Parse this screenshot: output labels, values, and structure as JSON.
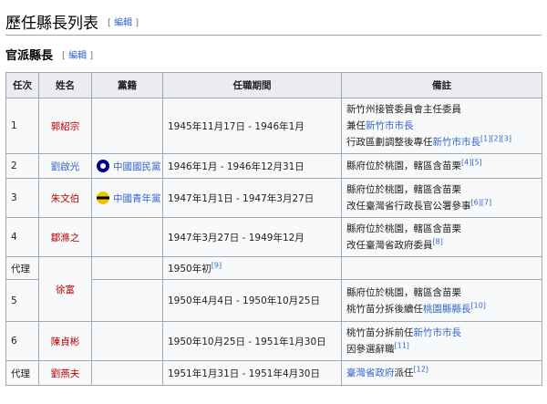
{
  "heading": {
    "title": "歷任縣長列表",
    "edit": "編輯"
  },
  "subheading": {
    "title": "官派縣長",
    "edit": "編輯"
  },
  "columns": [
    "任次",
    "姓名",
    "黨籍",
    "任職期間",
    "備註"
  ],
  "rows": {
    "r1": {
      "no": "1",
      "name": "郭紹宗",
      "period": "1945年11月17日 - 1946年1月",
      "note1": "新竹州接管委員會主任委員",
      "note2_pre": "兼任",
      "note2_link": "新竹市市長",
      "note3_pre": "行政區劃調整後專任",
      "note3_link": "新竹市市長",
      "note3_ref": "[1][2][3]"
    },
    "r2": {
      "no": "2",
      "name": "劉啟光",
      "party": "中國國民黨",
      "party_icon": "kmt-emblem-icon",
      "period": "1946年1月 - 1946年12月31日",
      "note1": "縣府位於桃園，轄區含苗栗",
      "note1_ref": "[4][5]"
    },
    "r3": {
      "no": "3",
      "name": "朱文伯",
      "party": "中國青年黨",
      "party_icon": "ycp-emblem-icon",
      "period": "1947年1月1日 - 1947年3月27日",
      "note1": "縣府位於桃園，轄區含苗栗",
      "note2": "改任臺灣省行政長官公署參事",
      "note2_ref": "[6][7]"
    },
    "r4": {
      "no": "4",
      "name": "鄒滌之",
      "period": "1947年3月27日 - 1949年12月",
      "note1": "縣府位於桃園，轄區含苗栗",
      "note2": "改任臺灣省政府委員",
      "note2_ref": "[8]"
    },
    "r5a": {
      "no": "代理",
      "name": "徐富",
      "period": "1950年初",
      "period_ref": "[9]"
    },
    "r5b": {
      "no": "5",
      "period": "1950年4月4日 - 1950年10月25日",
      "note1": "縣府位於桃園，轄區含苗栗",
      "note2_pre": "桃竹苗分拆後續任",
      "note2_link": "桃園縣縣長",
      "note2_ref": "[10]"
    },
    "r6": {
      "no": "6",
      "name": "陳貞彬",
      "period": "1950年10月25日 - 1951年1月30日",
      "note1_pre": "桃竹苗分拆前任",
      "note1_link": "新竹市市長",
      "note2": "因參選辭職",
      "note2_ref": "[11]"
    },
    "r7": {
      "no": "代理",
      "name": "劉燕夫",
      "period": "1951年1月31日 - 1951年4月30日",
      "note1_link": "臺灣省政府",
      "note1_post": "派任",
      "note1_ref": "[12]"
    }
  },
  "colors": {
    "link": "#3366cc",
    "redlink": "#ba0000",
    "header_bg": "#eaecf0",
    "border": "#a2a9b1"
  }
}
